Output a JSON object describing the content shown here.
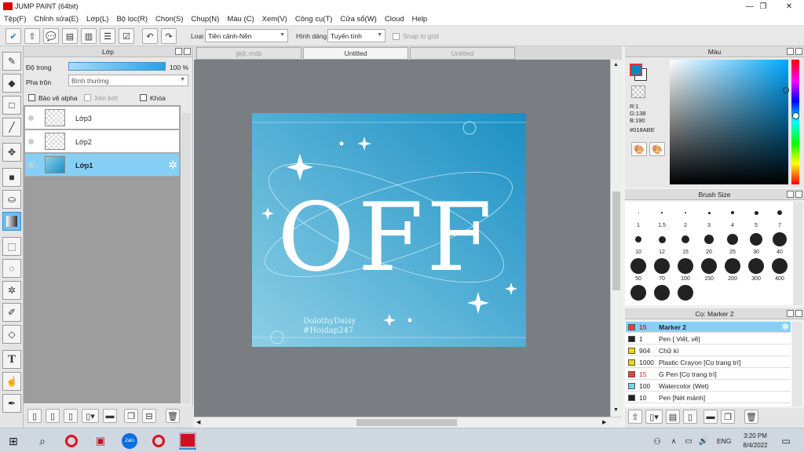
{
  "app": {
    "title": "JUMP PAINT (64bit)"
  },
  "window_controls": [
    "—",
    "❐",
    "✕"
  ],
  "menu": [
    "Tệp(F)",
    "Chỉnh sửa(E)",
    "Lớp(L)",
    "Bộ lọc(R)",
    "Chọn(S)",
    "Chụp(N)",
    "Màu (C)",
    "Xem(V)",
    "Công cụ(T)",
    "Cửa sổ(W)",
    "Cloud",
    "Help"
  ],
  "toolbar": {
    "type_label": "Loại",
    "type_value": "Tiền cảnh-Nền",
    "shape_label": "Hình dáng",
    "shape_value": "Tuyến tính",
    "snap_label": "Snap to grid"
  },
  "layer_panel": {
    "title": "Lớp",
    "opacity_label": "Độ trong",
    "opacity_value": "100 %",
    "blend_label": "Pha trộn",
    "blend_value": "Bình thường",
    "protect_alpha": "Bảo vệ alpha",
    "clip": "Xén bớt",
    "lock": "Khóa",
    "layers": [
      {
        "name": "Lớp3",
        "selected": false
      },
      {
        "name": "Lớp2",
        "selected": false
      },
      {
        "name": "Lớp1",
        "selected": true
      }
    ]
  },
  "tabs": [
    {
      "label": "jjkjl;.mdp",
      "active": false
    },
    {
      "label": "Untitled",
      "active": true
    },
    {
      "label": "Untitled",
      "active": false
    }
  ],
  "artwork": {
    "headline": "OFF",
    "signature_line1": "DolothyDaisy",
    "signature_line2": "#Hoidap247",
    "gradient_start": "#8ccfe6",
    "gradient_end": "#1a8fc4"
  },
  "color_panel": {
    "title": "Màu",
    "r": "R:1",
    "g": "G:138",
    "b": "B:190",
    "hex": "#018ABE",
    "fg_color": "#018abe",
    "bg_color": "#ffffff"
  },
  "brush_size_panel": {
    "title": "Brush Size",
    "sizes": [
      "1",
      "1.5",
      "2",
      "3",
      "4",
      "5",
      "7",
      "10",
      "12",
      "15",
      "20",
      "25",
      "30",
      "40",
      "50",
      "70",
      "100",
      "150",
      "200",
      "300",
      "400",
      "",
      "",
      ""
    ]
  },
  "brush_list": {
    "title": "Cọ: Marker 2",
    "items": [
      {
        "count": "15",
        "name": "Marker 2",
        "color": "#e84040",
        "active": true
      },
      {
        "count": "1",
        "name": "Pen [ Viết, vẽ]",
        "color": "#222222",
        "active": false
      },
      {
        "count": "904",
        "name": "Chữ kí",
        "color": "#f0d800",
        "active": false
      },
      {
        "count": "1000",
        "name": "Plastic Crayon [Cọ trang trí]",
        "color": "#f0d800",
        "active": false
      },
      {
        "count": "15",
        "name": "G Pen [Cọ trang trí]",
        "color": "#e84040",
        "active": false
      },
      {
        "count": "100",
        "name": "Watercolor (Wet)",
        "color": "#7ad4f0",
        "active": false
      },
      {
        "count": "10",
        "name": "Pen [Nét mảnh]",
        "color": "#222222",
        "active": false
      }
    ]
  },
  "taskbar": {
    "language": "ENG",
    "time": "3:20 PM",
    "date": "8/4/2022"
  }
}
